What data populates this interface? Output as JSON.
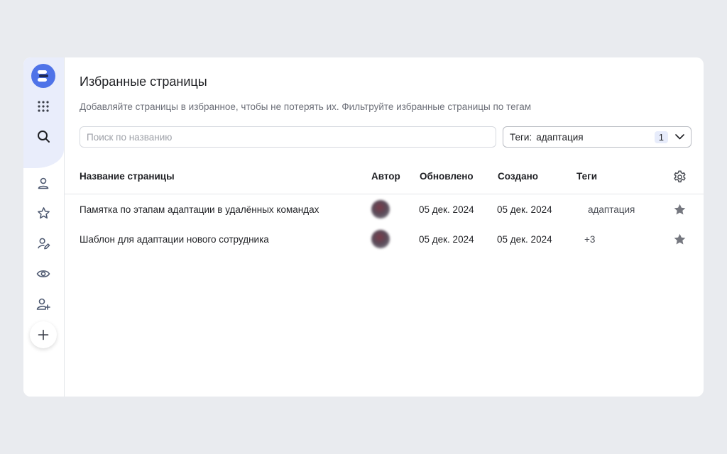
{
  "sidebar": {
    "logo": "service-logo-icon",
    "items": [
      {
        "icon": "apps-grid-icon",
        "name": "apps"
      },
      {
        "icon": "search-icon",
        "name": "search"
      },
      {
        "icon": "user-icon",
        "name": "profile"
      },
      {
        "icon": "star-icon",
        "name": "favorites"
      },
      {
        "icon": "user-edit-icon",
        "name": "my-pages"
      },
      {
        "icon": "eye-icon",
        "name": "watching"
      },
      {
        "icon": "user-add-icon",
        "name": "invite"
      }
    ],
    "add_icon": "plus-icon"
  },
  "page": {
    "title": "Избранные страницы",
    "description": "Добавляйте страницы в избранное, чтобы не потерять их. Фильтруйте избранные страницы по тегам"
  },
  "search": {
    "placeholder": "Поиск по названию",
    "value": ""
  },
  "tag_filter": {
    "label": "Теги:",
    "value": "адаптация",
    "count": "1"
  },
  "table": {
    "columns": {
      "name": "Название страницы",
      "author": "Автор",
      "updated": "Обновлено",
      "created": "Создано",
      "tags": "Теги"
    },
    "rows": [
      {
        "name": "Памятка по этапам адаптации в удалённых командах",
        "updated": "05 дек. 2024",
        "created": "05 дек. 2024",
        "tags": "адаптация",
        "favorite": true
      },
      {
        "name": "Шаблон для адаптации нового сотрудника",
        "updated": "05 дек. 2024",
        "created": "05 дек. 2024",
        "tags": "+3",
        "favorite": true
      }
    ]
  },
  "colors": {
    "accent": "#4f73e8",
    "sidebar_highlight": "#e9edfb",
    "background": "#e9ebef",
    "icon": "#4d5870"
  }
}
